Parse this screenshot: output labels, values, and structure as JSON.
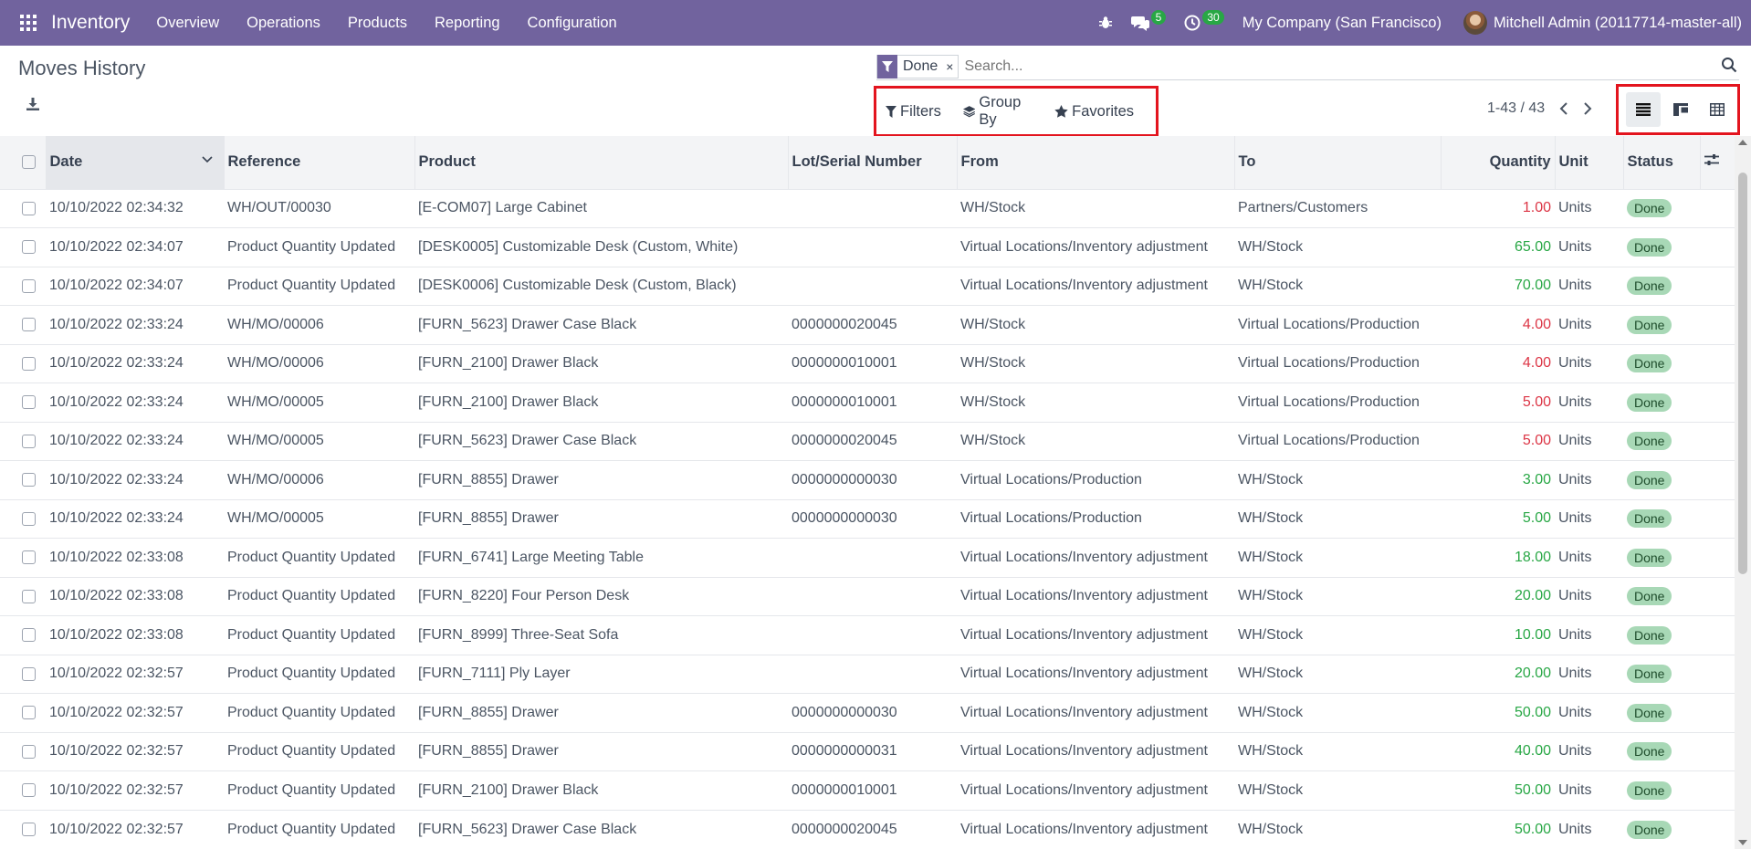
{
  "navbar": {
    "brand": "Inventory",
    "menu": [
      "Overview",
      "Operations",
      "Products",
      "Reporting",
      "Configuration"
    ],
    "messages_count": "5",
    "activities_count": "30",
    "company": "My Company (San Francisco)",
    "user": "Mitchell Admin (20117714-master-all)"
  },
  "page": {
    "title": "Moves History"
  },
  "search": {
    "facet": "Done",
    "remove": "×",
    "placeholder": "Search..."
  },
  "filters": {
    "filters_label": "Filters",
    "groupby_label": "Group By",
    "favorites_label": "Favorites"
  },
  "pager": {
    "value": "1-43 / 43"
  },
  "table": {
    "headers": [
      "Date",
      "Reference",
      "Product",
      "Lot/Serial Number",
      "From",
      "To",
      "Quantity",
      "Unit",
      "Status"
    ],
    "rows": [
      [
        "10/10/2022 02:34:32",
        "WH/OUT/00030",
        "[E-COM07] Large Cabinet",
        "",
        "WH/Stock",
        "Partners/Customers",
        "1.00",
        "Units",
        "Done",
        "neg"
      ],
      [
        "10/10/2022 02:34:07",
        "Product Quantity Updated",
        "[DESK0005] Customizable Desk (Custom, White)",
        "",
        "Virtual Locations/Inventory adjustment",
        "WH/Stock",
        "65.00",
        "Units",
        "Done",
        "pos"
      ],
      [
        "10/10/2022 02:34:07",
        "Product Quantity Updated",
        "[DESK0006] Customizable Desk (Custom, Black)",
        "",
        "Virtual Locations/Inventory adjustment",
        "WH/Stock",
        "70.00",
        "Units",
        "Done",
        "pos"
      ],
      [
        "10/10/2022 02:33:24",
        "WH/MO/00006",
        "[FURN_5623] Drawer Case Black",
        "0000000020045",
        "WH/Stock",
        "Virtual Locations/Production",
        "4.00",
        "Units",
        "Done",
        "neg"
      ],
      [
        "10/10/2022 02:33:24",
        "WH/MO/00006",
        "[FURN_2100] Drawer Black",
        "0000000010001",
        "WH/Stock",
        "Virtual Locations/Production",
        "4.00",
        "Units",
        "Done",
        "neg"
      ],
      [
        "10/10/2022 02:33:24",
        "WH/MO/00005",
        "[FURN_2100] Drawer Black",
        "0000000010001",
        "WH/Stock",
        "Virtual Locations/Production",
        "5.00",
        "Units",
        "Done",
        "neg"
      ],
      [
        "10/10/2022 02:33:24",
        "WH/MO/00005",
        "[FURN_5623] Drawer Case Black",
        "0000000020045",
        "WH/Stock",
        "Virtual Locations/Production",
        "5.00",
        "Units",
        "Done",
        "neg"
      ],
      [
        "10/10/2022 02:33:24",
        "WH/MO/00006",
        "[FURN_8855] Drawer",
        "0000000000030",
        "Virtual Locations/Production",
        "WH/Stock",
        "3.00",
        "Units",
        "Done",
        "pos"
      ],
      [
        "10/10/2022 02:33:24",
        "WH/MO/00005",
        "[FURN_8855] Drawer",
        "0000000000030",
        "Virtual Locations/Production",
        "WH/Stock",
        "5.00",
        "Units",
        "Done",
        "pos"
      ],
      [
        "10/10/2022 02:33:08",
        "Product Quantity Updated",
        "[FURN_6741] Large Meeting Table",
        "",
        "Virtual Locations/Inventory adjustment",
        "WH/Stock",
        "18.00",
        "Units",
        "Done",
        "pos"
      ],
      [
        "10/10/2022 02:33:08",
        "Product Quantity Updated",
        "[FURN_8220] Four Person Desk",
        "",
        "Virtual Locations/Inventory adjustment",
        "WH/Stock",
        "20.00",
        "Units",
        "Done",
        "pos"
      ],
      [
        "10/10/2022 02:33:08",
        "Product Quantity Updated",
        "[FURN_8999] Three-Seat Sofa",
        "",
        "Virtual Locations/Inventory adjustment",
        "WH/Stock",
        "10.00",
        "Units",
        "Done",
        "pos"
      ],
      [
        "10/10/2022 02:32:57",
        "Product Quantity Updated",
        "[FURN_7111] Ply Layer",
        "",
        "Virtual Locations/Inventory adjustment",
        "WH/Stock",
        "20.00",
        "Units",
        "Done",
        "pos"
      ],
      [
        "10/10/2022 02:32:57",
        "Product Quantity Updated",
        "[FURN_8855] Drawer",
        "0000000000030",
        "Virtual Locations/Inventory adjustment",
        "WH/Stock",
        "50.00",
        "Units",
        "Done",
        "pos"
      ],
      [
        "10/10/2022 02:32:57",
        "Product Quantity Updated",
        "[FURN_8855] Drawer",
        "0000000000031",
        "Virtual Locations/Inventory adjustment",
        "WH/Stock",
        "40.00",
        "Units",
        "Done",
        "pos"
      ],
      [
        "10/10/2022 02:32:57",
        "Product Quantity Updated",
        "[FURN_2100] Drawer Black",
        "0000000010001",
        "Virtual Locations/Inventory adjustment",
        "WH/Stock",
        "50.00",
        "Units",
        "Done",
        "pos"
      ],
      [
        "10/10/2022 02:32:57",
        "Product Quantity Updated",
        "[FURN_5623] Drawer Case Black",
        "0000000020045",
        "Virtual Locations/Inventory adjustment",
        "WH/Stock",
        "50.00",
        "Units",
        "Done",
        "pos"
      ]
    ]
  },
  "colors": {
    "navbar": "#71639e",
    "highlight_border": "#e3141e",
    "negative_qty": "#dc3545",
    "positive_qty": "#28a745",
    "status_badge": "#a8d8b6"
  }
}
